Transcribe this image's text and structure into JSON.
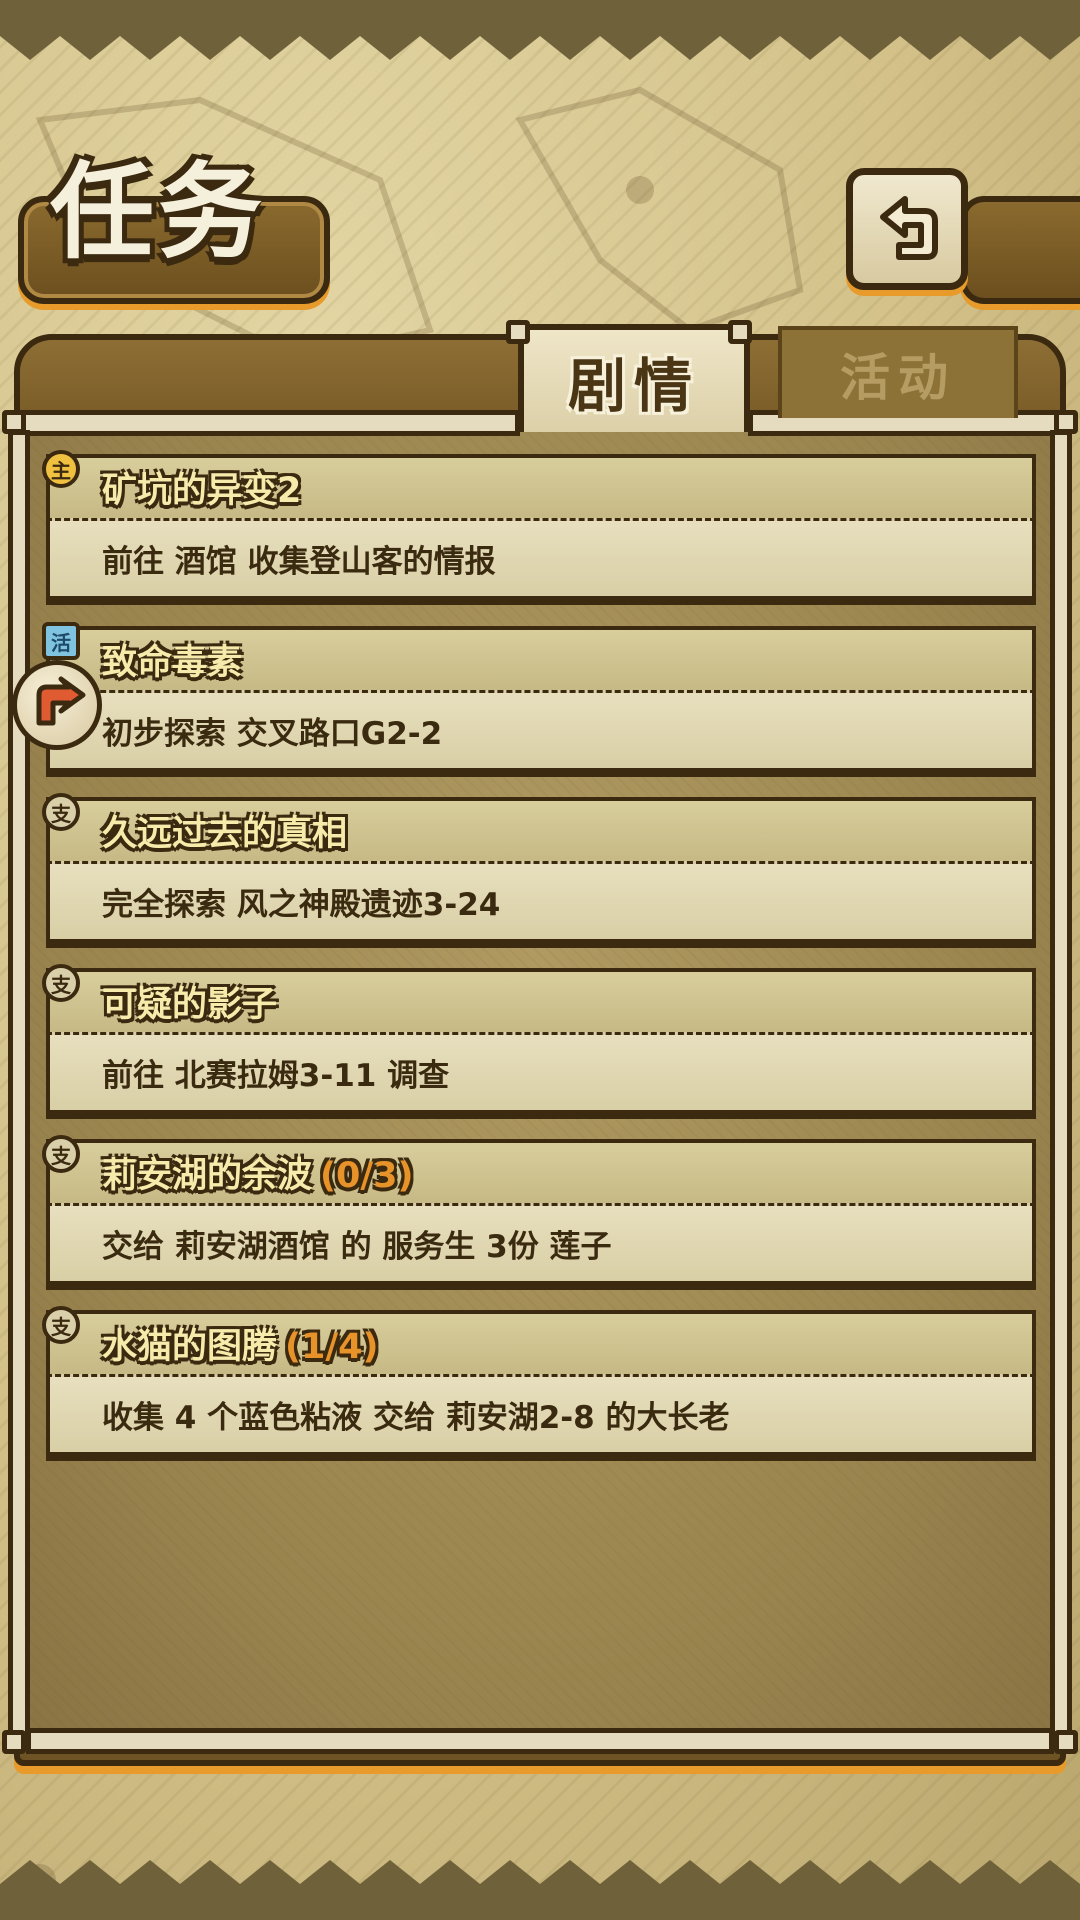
{
  "header": {
    "title": "任务",
    "back_icon": "return-arrow-icon"
  },
  "tabs": [
    {
      "label": "剧情",
      "active": true
    },
    {
      "label": "活动",
      "active": false
    }
  ],
  "quests": [
    {
      "type_badge": "主",
      "type": "main",
      "title": "矿坑的异变2",
      "progress": "",
      "desc": "前往 酒馆 收集登山客的情报"
    },
    {
      "type_badge": "活",
      "type": "daily",
      "title": "致命毒素",
      "progress": "",
      "desc": "初步探索 交叉路口G2-2",
      "tracked": true
    },
    {
      "type_badge": "支",
      "type": "side",
      "title": "久远过去的真相",
      "progress": "",
      "desc": "完全探索 风之神殿遗迹3-24"
    },
    {
      "type_badge": "支",
      "type": "side",
      "title": "可疑的影子",
      "progress": "",
      "desc": "前往 北赛拉姆3-11 调查"
    },
    {
      "type_badge": "支",
      "type": "side",
      "title": "莉安湖的余波",
      "progress": "(0/3)",
      "desc": "交给 莉安湖酒馆 的 服务生 3份 莲子"
    },
    {
      "type_badge": "支",
      "type": "side",
      "title": "水猫的图腾",
      "progress": "(1/4)",
      "desc": "收集 4 个蓝色粘液 交给 莉安湖2-8 的大长老"
    }
  ],
  "colors": {
    "outline": "#3b2a10",
    "accent_orange": "#e89a2a",
    "title_yellow": "#f6ebab",
    "parchment": "#d6c690"
  }
}
